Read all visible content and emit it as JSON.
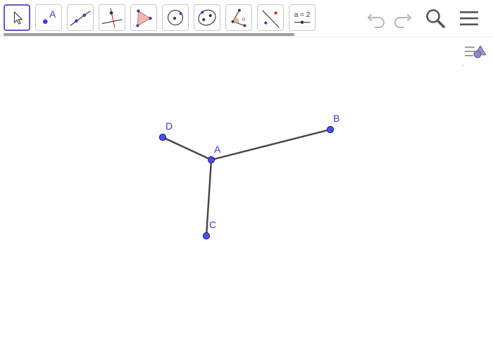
{
  "toolbar": {
    "tools": [
      {
        "name": "move-tool",
        "icon": "arrow-pointer-icon",
        "selected": true
      },
      {
        "name": "point-tool",
        "icon": "point-icon",
        "label": "A"
      },
      {
        "name": "line-tool",
        "icon": "line-icon"
      },
      {
        "name": "perpendicular-line-tool",
        "icon": "perpendicular-line-icon"
      },
      {
        "name": "polygon-tool",
        "icon": "polygon-icon"
      },
      {
        "name": "circle-tool",
        "icon": "circle-center-point-icon"
      },
      {
        "name": "conic-tool",
        "icon": "ellipse-icon"
      },
      {
        "name": "angle-tool",
        "icon": "angle-icon"
      },
      {
        "name": "reflect-tool",
        "icon": "reflect-about-line-icon"
      },
      {
        "name": "slider-tool",
        "icon": "slider-icon",
        "label": "a = 2"
      }
    ],
    "undo_icon": "undo-icon",
    "redo_icon": "redo-icon",
    "search_icon": "search-icon",
    "menu_icon": "hamburger-menu-icon"
  },
  "canvas": {
    "points": [
      {
        "name": "A",
        "label": "A"
      },
      {
        "name": "B",
        "label": "B"
      },
      {
        "name": "C",
        "label": "C"
      },
      {
        "name": "D",
        "label": "D"
      }
    ],
    "segments": [
      {
        "from": "A",
        "to": "B"
      },
      {
        "from": "A",
        "to": "C"
      },
      {
        "from": "A",
        "to": "D"
      }
    ]
  },
  "colors": {
    "accent": "#6557d2",
    "point_fill": "#4d4dff",
    "point_stroke": "#1a1a66",
    "segment": "#444444",
    "label": "#3b3bd6"
  }
}
